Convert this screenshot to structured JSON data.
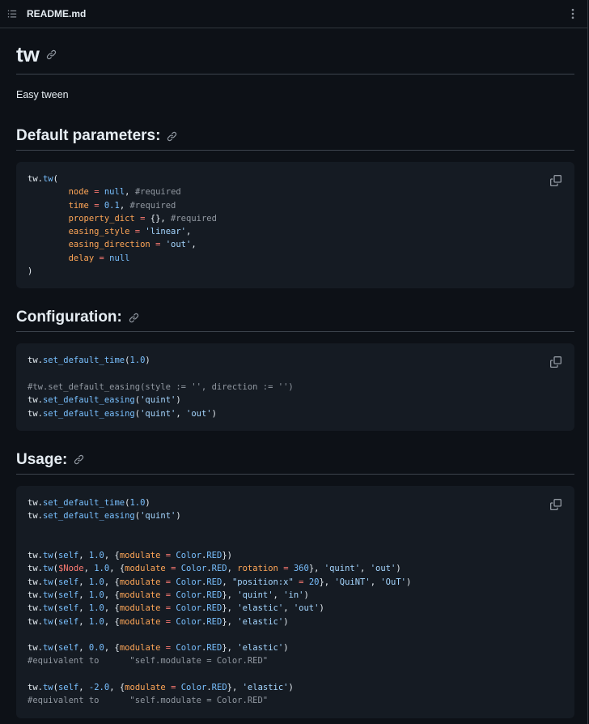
{
  "file": {
    "name": "README.md",
    "toc_icon": "list-unordered-icon",
    "menu_icon": "kebab-horizontal-icon"
  },
  "readme": {
    "title": "tw",
    "description": "Easy tween",
    "sections": [
      {
        "heading": "Default parameters:",
        "code": [
          [
            [
              "plain",
              "tw."
            ],
            [
              "fn",
              "tw"
            ],
            [
              "plain",
              "("
            ]
          ],
          [
            [
              "plain",
              "        "
            ],
            [
              "param",
              "node"
            ],
            [
              "plain",
              " "
            ],
            [
              "op",
              "="
            ],
            [
              "plain",
              " "
            ],
            [
              "kw",
              "null"
            ],
            [
              "plain",
              ", "
            ],
            [
              "comment",
              "#required"
            ]
          ],
          [
            [
              "plain",
              "        "
            ],
            [
              "param",
              "time"
            ],
            [
              "plain",
              " "
            ],
            [
              "op",
              "="
            ],
            [
              "plain",
              " "
            ],
            [
              "num",
              "0.1"
            ],
            [
              "plain",
              ", "
            ],
            [
              "comment",
              "#required"
            ]
          ],
          [
            [
              "plain",
              "        "
            ],
            [
              "param",
              "property_dict"
            ],
            [
              "plain",
              " "
            ],
            [
              "op",
              "="
            ],
            [
              "plain",
              " {}, "
            ],
            [
              "comment",
              "#required"
            ]
          ],
          [
            [
              "plain",
              "        "
            ],
            [
              "param",
              "easing_style"
            ],
            [
              "plain",
              " "
            ],
            [
              "op",
              "="
            ],
            [
              "plain",
              " "
            ],
            [
              "str",
              "'linear'"
            ],
            [
              "plain",
              ","
            ]
          ],
          [
            [
              "plain",
              "        "
            ],
            [
              "param",
              "easing_direction"
            ],
            [
              "plain",
              " "
            ],
            [
              "op",
              "="
            ],
            [
              "plain",
              " "
            ],
            [
              "str",
              "'out'"
            ],
            [
              "plain",
              ","
            ]
          ],
          [
            [
              "plain",
              "        "
            ],
            [
              "param",
              "delay"
            ],
            [
              "plain",
              " "
            ],
            [
              "op",
              "="
            ],
            [
              "plain",
              " "
            ],
            [
              "kw",
              "null"
            ]
          ],
          [
            [
              "plain",
              ")"
            ]
          ]
        ]
      },
      {
        "heading": "Configuration:",
        "code": [
          [
            [
              "plain",
              "tw."
            ],
            [
              "fn",
              "set_default_time"
            ],
            [
              "plain",
              "("
            ],
            [
              "num",
              "1.0"
            ],
            [
              "plain",
              ")"
            ]
          ],
          [],
          [
            [
              "comment",
              "#tw.set_default_easing(style := '', direction := '')"
            ]
          ],
          [
            [
              "plain",
              "tw."
            ],
            [
              "fn",
              "set_default_easing"
            ],
            [
              "plain",
              "("
            ],
            [
              "str",
              "'quint'"
            ],
            [
              "plain",
              ")"
            ]
          ],
          [
            [
              "plain",
              "tw."
            ],
            [
              "fn",
              "set_default_easing"
            ],
            [
              "plain",
              "("
            ],
            [
              "str",
              "'quint'"
            ],
            [
              "plain",
              ", "
            ],
            [
              "str",
              "'out'"
            ],
            [
              "plain",
              ")"
            ]
          ]
        ]
      },
      {
        "heading": "Usage:",
        "code": [
          [
            [
              "plain",
              "tw."
            ],
            [
              "fn",
              "set_default_time"
            ],
            [
              "plain",
              "("
            ],
            [
              "num",
              "1.0"
            ],
            [
              "plain",
              ")"
            ]
          ],
          [
            [
              "plain",
              "tw."
            ],
            [
              "fn",
              "set_default_easing"
            ],
            [
              "plain",
              "("
            ],
            [
              "str",
              "'quint'"
            ],
            [
              "plain",
              ")"
            ]
          ],
          [],
          [],
          [
            [
              "plain",
              "tw."
            ],
            [
              "fn",
              "tw"
            ],
            [
              "plain",
              "("
            ],
            [
              "kw",
              "self"
            ],
            [
              "plain",
              ", "
            ],
            [
              "num",
              "1.0"
            ],
            [
              "plain",
              ", {"
            ],
            [
              "param",
              "modulate"
            ],
            [
              "plain",
              " "
            ],
            [
              "op",
              "="
            ],
            [
              "plain",
              " "
            ],
            [
              "fn",
              "Color"
            ],
            [
              "plain",
              "."
            ],
            [
              "fn",
              "RED"
            ],
            [
              "plain",
              "})"
            ]
          ],
          [
            [
              "plain",
              "tw."
            ],
            [
              "fn",
              "tw"
            ],
            [
              "plain",
              "("
            ],
            [
              "var",
              "$Node"
            ],
            [
              "plain",
              ", "
            ],
            [
              "num",
              "1.0"
            ],
            [
              "plain",
              ", {"
            ],
            [
              "param",
              "modulate"
            ],
            [
              "plain",
              " "
            ],
            [
              "op",
              "="
            ],
            [
              "plain",
              " "
            ],
            [
              "fn",
              "Color"
            ],
            [
              "plain",
              "."
            ],
            [
              "fn",
              "RED"
            ],
            [
              "plain",
              ", "
            ],
            [
              "param",
              "rotation"
            ],
            [
              "plain",
              " "
            ],
            [
              "op",
              "="
            ],
            [
              "plain",
              " "
            ],
            [
              "num",
              "360"
            ],
            [
              "plain",
              "}, "
            ],
            [
              "str",
              "'quint'"
            ],
            [
              "plain",
              ", "
            ],
            [
              "str",
              "'out'"
            ],
            [
              "plain",
              ")"
            ]
          ],
          [
            [
              "plain",
              "tw."
            ],
            [
              "fn",
              "tw"
            ],
            [
              "plain",
              "("
            ],
            [
              "kw",
              "self"
            ],
            [
              "plain",
              ", "
            ],
            [
              "num",
              "1.0"
            ],
            [
              "plain",
              ", {"
            ],
            [
              "param",
              "modulate"
            ],
            [
              "plain",
              " "
            ],
            [
              "op",
              "="
            ],
            [
              "plain",
              " "
            ],
            [
              "fn",
              "Color"
            ],
            [
              "plain",
              "."
            ],
            [
              "fn",
              "RED"
            ],
            [
              "plain",
              ", "
            ],
            [
              "str",
              "\"position:x\""
            ],
            [
              "plain",
              " "
            ],
            [
              "op",
              "="
            ],
            [
              "plain",
              " "
            ],
            [
              "num",
              "20"
            ],
            [
              "plain",
              "}, "
            ],
            [
              "str",
              "'QuiNT'"
            ],
            [
              "plain",
              ", "
            ],
            [
              "str",
              "'OuT'"
            ],
            [
              "plain",
              ")"
            ]
          ],
          [
            [
              "plain",
              "tw."
            ],
            [
              "fn",
              "tw"
            ],
            [
              "plain",
              "("
            ],
            [
              "kw",
              "self"
            ],
            [
              "plain",
              ", "
            ],
            [
              "num",
              "1.0"
            ],
            [
              "plain",
              ", {"
            ],
            [
              "param",
              "modulate"
            ],
            [
              "plain",
              " "
            ],
            [
              "op",
              "="
            ],
            [
              "plain",
              " "
            ],
            [
              "fn",
              "Color"
            ],
            [
              "plain",
              "."
            ],
            [
              "fn",
              "RED"
            ],
            [
              "plain",
              "}, "
            ],
            [
              "str",
              "'quint'"
            ],
            [
              "plain",
              ", "
            ],
            [
              "str",
              "'in'"
            ],
            [
              "plain",
              ")"
            ]
          ],
          [
            [
              "plain",
              "tw."
            ],
            [
              "fn",
              "tw"
            ],
            [
              "plain",
              "("
            ],
            [
              "kw",
              "self"
            ],
            [
              "plain",
              ", "
            ],
            [
              "num",
              "1.0"
            ],
            [
              "plain",
              ", {"
            ],
            [
              "param",
              "modulate"
            ],
            [
              "plain",
              " "
            ],
            [
              "op",
              "="
            ],
            [
              "plain",
              " "
            ],
            [
              "fn",
              "Color"
            ],
            [
              "plain",
              "."
            ],
            [
              "fn",
              "RED"
            ],
            [
              "plain",
              "}, "
            ],
            [
              "str",
              "'elastic'"
            ],
            [
              "plain",
              ", "
            ],
            [
              "str",
              "'out'"
            ],
            [
              "plain",
              ")"
            ]
          ],
          [
            [
              "plain",
              "tw."
            ],
            [
              "fn",
              "tw"
            ],
            [
              "plain",
              "("
            ],
            [
              "kw",
              "self"
            ],
            [
              "plain",
              ", "
            ],
            [
              "num",
              "1.0"
            ],
            [
              "plain",
              ", {"
            ],
            [
              "param",
              "modulate"
            ],
            [
              "plain",
              " "
            ],
            [
              "op",
              "="
            ],
            [
              "plain",
              " "
            ],
            [
              "fn",
              "Color"
            ],
            [
              "plain",
              "."
            ],
            [
              "fn",
              "RED"
            ],
            [
              "plain",
              "}, "
            ],
            [
              "str",
              "'elastic'"
            ],
            [
              "plain",
              ")"
            ]
          ],
          [],
          [
            [
              "plain",
              "tw."
            ],
            [
              "fn",
              "tw"
            ],
            [
              "plain",
              "("
            ],
            [
              "kw",
              "self"
            ],
            [
              "plain",
              ", "
            ],
            [
              "num",
              "0.0"
            ],
            [
              "plain",
              ", {"
            ],
            [
              "param",
              "modulate"
            ],
            [
              "plain",
              " "
            ],
            [
              "op",
              "="
            ],
            [
              "plain",
              " "
            ],
            [
              "fn",
              "Color"
            ],
            [
              "plain",
              "."
            ],
            [
              "fn",
              "RED"
            ],
            [
              "plain",
              "}, "
            ],
            [
              "str",
              "'elastic'"
            ],
            [
              "plain",
              ")"
            ]
          ],
          [
            [
              "comment",
              "#equivalent to      \"self.modulate = Color.RED\""
            ]
          ],
          [],
          [
            [
              "plain",
              "tw."
            ],
            [
              "fn",
              "tw"
            ],
            [
              "plain",
              "("
            ],
            [
              "kw",
              "self"
            ],
            [
              "plain",
              ", "
            ],
            [
              "num",
              "-2.0"
            ],
            [
              "plain",
              ", {"
            ],
            [
              "param",
              "modulate"
            ],
            [
              "plain",
              " "
            ],
            [
              "op",
              "="
            ],
            [
              "plain",
              " "
            ],
            [
              "fn",
              "Color"
            ],
            [
              "plain",
              "."
            ],
            [
              "fn",
              "RED"
            ],
            [
              "plain",
              "}, "
            ],
            [
              "str",
              "'elastic'"
            ],
            [
              "plain",
              ")"
            ]
          ],
          [
            [
              "comment",
              "#equivalent to      \"self.modulate = Color.RED\""
            ]
          ]
        ]
      }
    ]
  },
  "icons": {
    "anchor": "link-icon",
    "copy": "copy-icon"
  },
  "colors": {
    "background": "#0d1117",
    "code_background": "#151b23",
    "border": "#30363d",
    "text": "#e6edf3",
    "function": "#79c0ff",
    "parameter": "#ffa657",
    "string": "#a5d6ff",
    "comment": "#9198a1",
    "operator": "#ff7b72"
  }
}
